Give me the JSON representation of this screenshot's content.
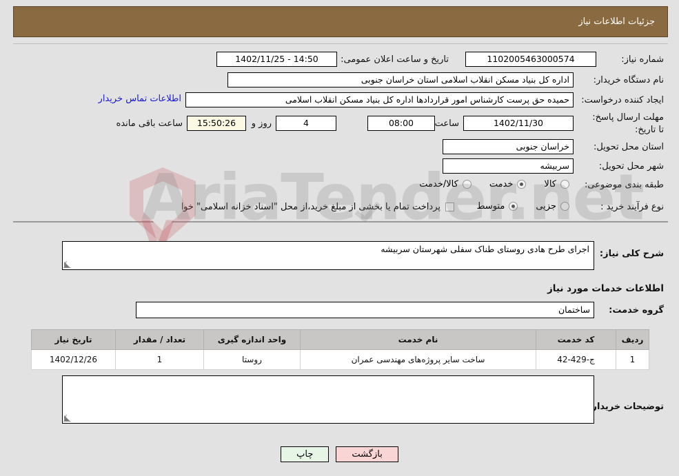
{
  "header": {
    "title": "جزئیات اطلاعات نیاز"
  },
  "colors": {
    "header_bg": "#8a6a41",
    "page_bg": "#e2e2e2",
    "link": "#1a19d6",
    "table_header_bg": "#c9c7c5",
    "countdown_bg": "#fbf8e4",
    "print_btn_bg": "#e6f5e6",
    "back_btn_bg": "#fad5d5"
  },
  "watermark": {
    "text": "AriaTender.net"
  },
  "form": {
    "need_number_label": "شماره نیاز:",
    "need_number_value": "1102005463000574",
    "announce_datetime_label": "تاریخ و ساعت اعلان عمومی:",
    "announce_datetime_value": "14:50 - 1402/11/25",
    "buyer_org_label": "نام دستگاه خریدار:",
    "buyer_org_value": "اداره کل بنیاد مسکن انقلاب اسلامی استان خراسان جنوبی",
    "requester_label": "ایجاد کننده درخواست:",
    "requester_value": "حمیده حق پرست کارشناس امور قراردادها اداره کل بنیاد مسکن انقلاب اسلامی",
    "buyer_contact_link": "اطلاعات تماس خریدار",
    "deadline_label": "مهلت ارسال پاسخ: تا تاریخ:",
    "deadline_date": "1402/11/30",
    "deadline_hour_label": "ساعت",
    "deadline_hour_value": "08:00",
    "days_value": "4",
    "days_unit_label": "روز و",
    "countdown_value": "15:50:26",
    "countdown_unit_label": "ساعت باقی مانده",
    "province_label": "استان محل تحویل:",
    "province_value": "خراسان جنوبی",
    "city_label": "شهر محل تحویل:",
    "city_value": "سربیشه",
    "category_label": "طبقه بندی موضوعی:",
    "category_options": [
      {
        "label": "کالا",
        "selected": false
      },
      {
        "label": "خدمت",
        "selected": true
      },
      {
        "label": "کالا/خدمت",
        "selected": false
      }
    ],
    "process_label": "نوع فرآیند خرید :",
    "process_options": [
      {
        "label": "جزیی",
        "selected": false
      },
      {
        "label": "متوسط",
        "selected": true
      }
    ],
    "treasury_checkbox_label": "پرداخت تمام یا بخشی از مبلغ خرید،از محل \"اسناد خزانه اسلامی\" خواهد بود.",
    "treasury_checked": false
  },
  "description": {
    "label": "شرح کلی نیاز:",
    "value": "اجرای طرح هادی روستای طناک سفلی شهرستان سربیشه"
  },
  "services": {
    "section_title": "اطلاعات خدمات مورد نیاز",
    "group_label": "گروه خدمت:",
    "group_value": "ساختمان",
    "table": {
      "columns": [
        "ردیف",
        "کد خدمت",
        "نام خدمت",
        "واحد اندازه گیری",
        "تعداد / مقدار",
        "تاریخ نیاز"
      ],
      "rows": [
        {
          "index": "1",
          "code": "ج-429-42",
          "name": "ساخت سایر پروژه‌های مهندسی عمران",
          "unit": "روستا",
          "quantity": "1",
          "need_date": "1402/12/26"
        }
      ]
    }
  },
  "buyer_notes": {
    "label": "توضیحات خریدار:",
    "value": ""
  },
  "buttons": {
    "print": "چاپ",
    "back": "بازگشت"
  }
}
